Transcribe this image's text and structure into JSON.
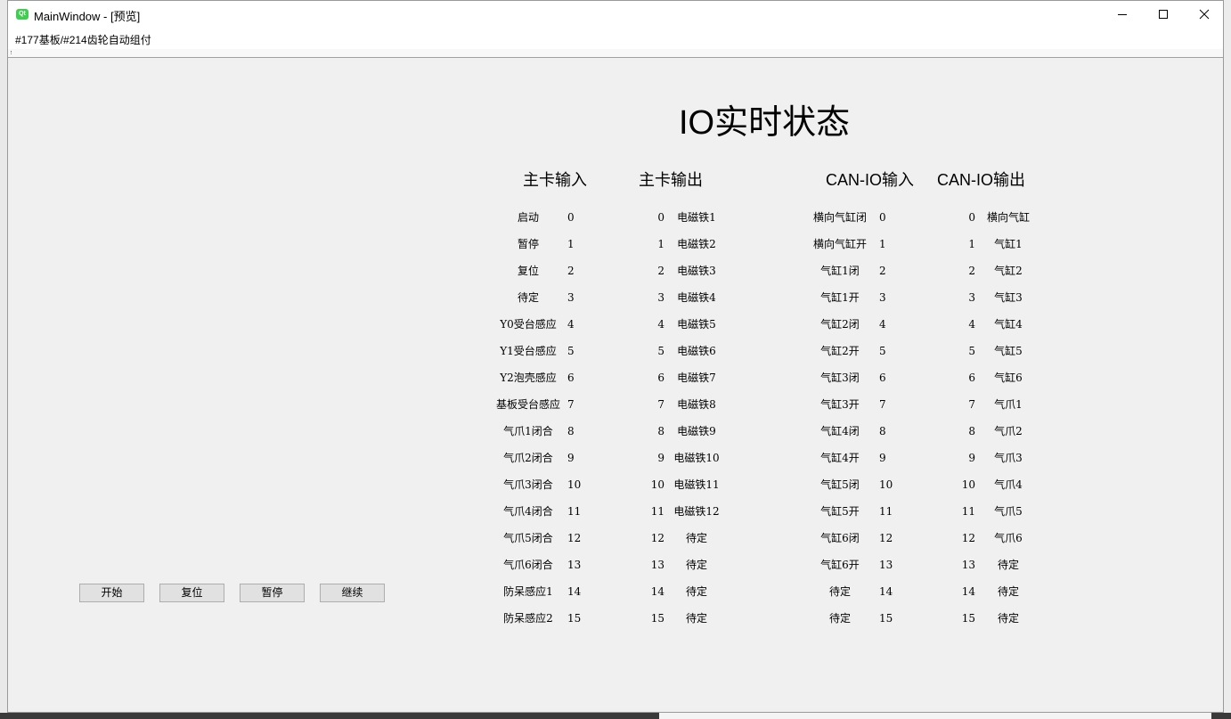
{
  "window": {
    "title": "MainWindow - [预览]",
    "icon": "qt-icon",
    "controls": {
      "minimize": "minimize-icon",
      "maximize": "maximize-icon",
      "close": "close-icon"
    }
  },
  "menu": {
    "item": "#177基板/#214齿轮自动组付"
  },
  "io": {
    "title": "IO实时状态",
    "headers": [
      "主卡输入",
      "主卡输出",
      "CAN-IO输入",
      "CAN-IO输出"
    ],
    "main_in_labels": [
      "启动",
      "暂停",
      "复位",
      "待定",
      "Y0受台感应",
      "Y1受台感应",
      "Y2泡壳感应",
      "基板受台感应",
      "气爪1闭合",
      "气爪2闭合",
      "气爪3闭合",
      "气爪4闭合",
      "气爪5闭合",
      "气爪6闭合",
      "防呆感应1",
      "防呆感应2"
    ],
    "main_out_labels": [
      "电磁铁1",
      "电磁铁2",
      "电磁铁3",
      "电磁铁4",
      "电磁铁5",
      "电磁铁6",
      "电磁铁7",
      "电磁铁8",
      "电磁铁9",
      "电磁铁10",
      "电磁铁11",
      "电磁铁12",
      "待定",
      "待定",
      "待定",
      "待定"
    ],
    "can_in_labels": [
      "横向气缸闭",
      "横向气缸开",
      "气缸1闭",
      "气缸1开",
      "气缸2闭",
      "气缸2开",
      "气缸3闭",
      "气缸3开",
      "气缸4闭",
      "气缸4开",
      "气缸5闭",
      "气缸5开",
      "气缸6闭",
      "气缸6开",
      "待定",
      "待定"
    ],
    "can_out_labels": [
      "横向气缸",
      "气缸1",
      "气缸2",
      "气缸3",
      "气缸4",
      "气缸5",
      "气缸6",
      "气爪1",
      "气爪2",
      "气爪3",
      "气爪4",
      "气爪5",
      "气爪6",
      "待定",
      "待定",
      "待定"
    ],
    "indices": [
      "0",
      "1",
      "2",
      "3",
      "4",
      "5",
      "6",
      "7",
      "8",
      "9",
      "10",
      "11",
      "12",
      "13",
      "14",
      "15"
    ]
  },
  "buttons": {
    "start": "开始",
    "reset": "复位",
    "pause": "暂停",
    "resume": "继续"
  }
}
